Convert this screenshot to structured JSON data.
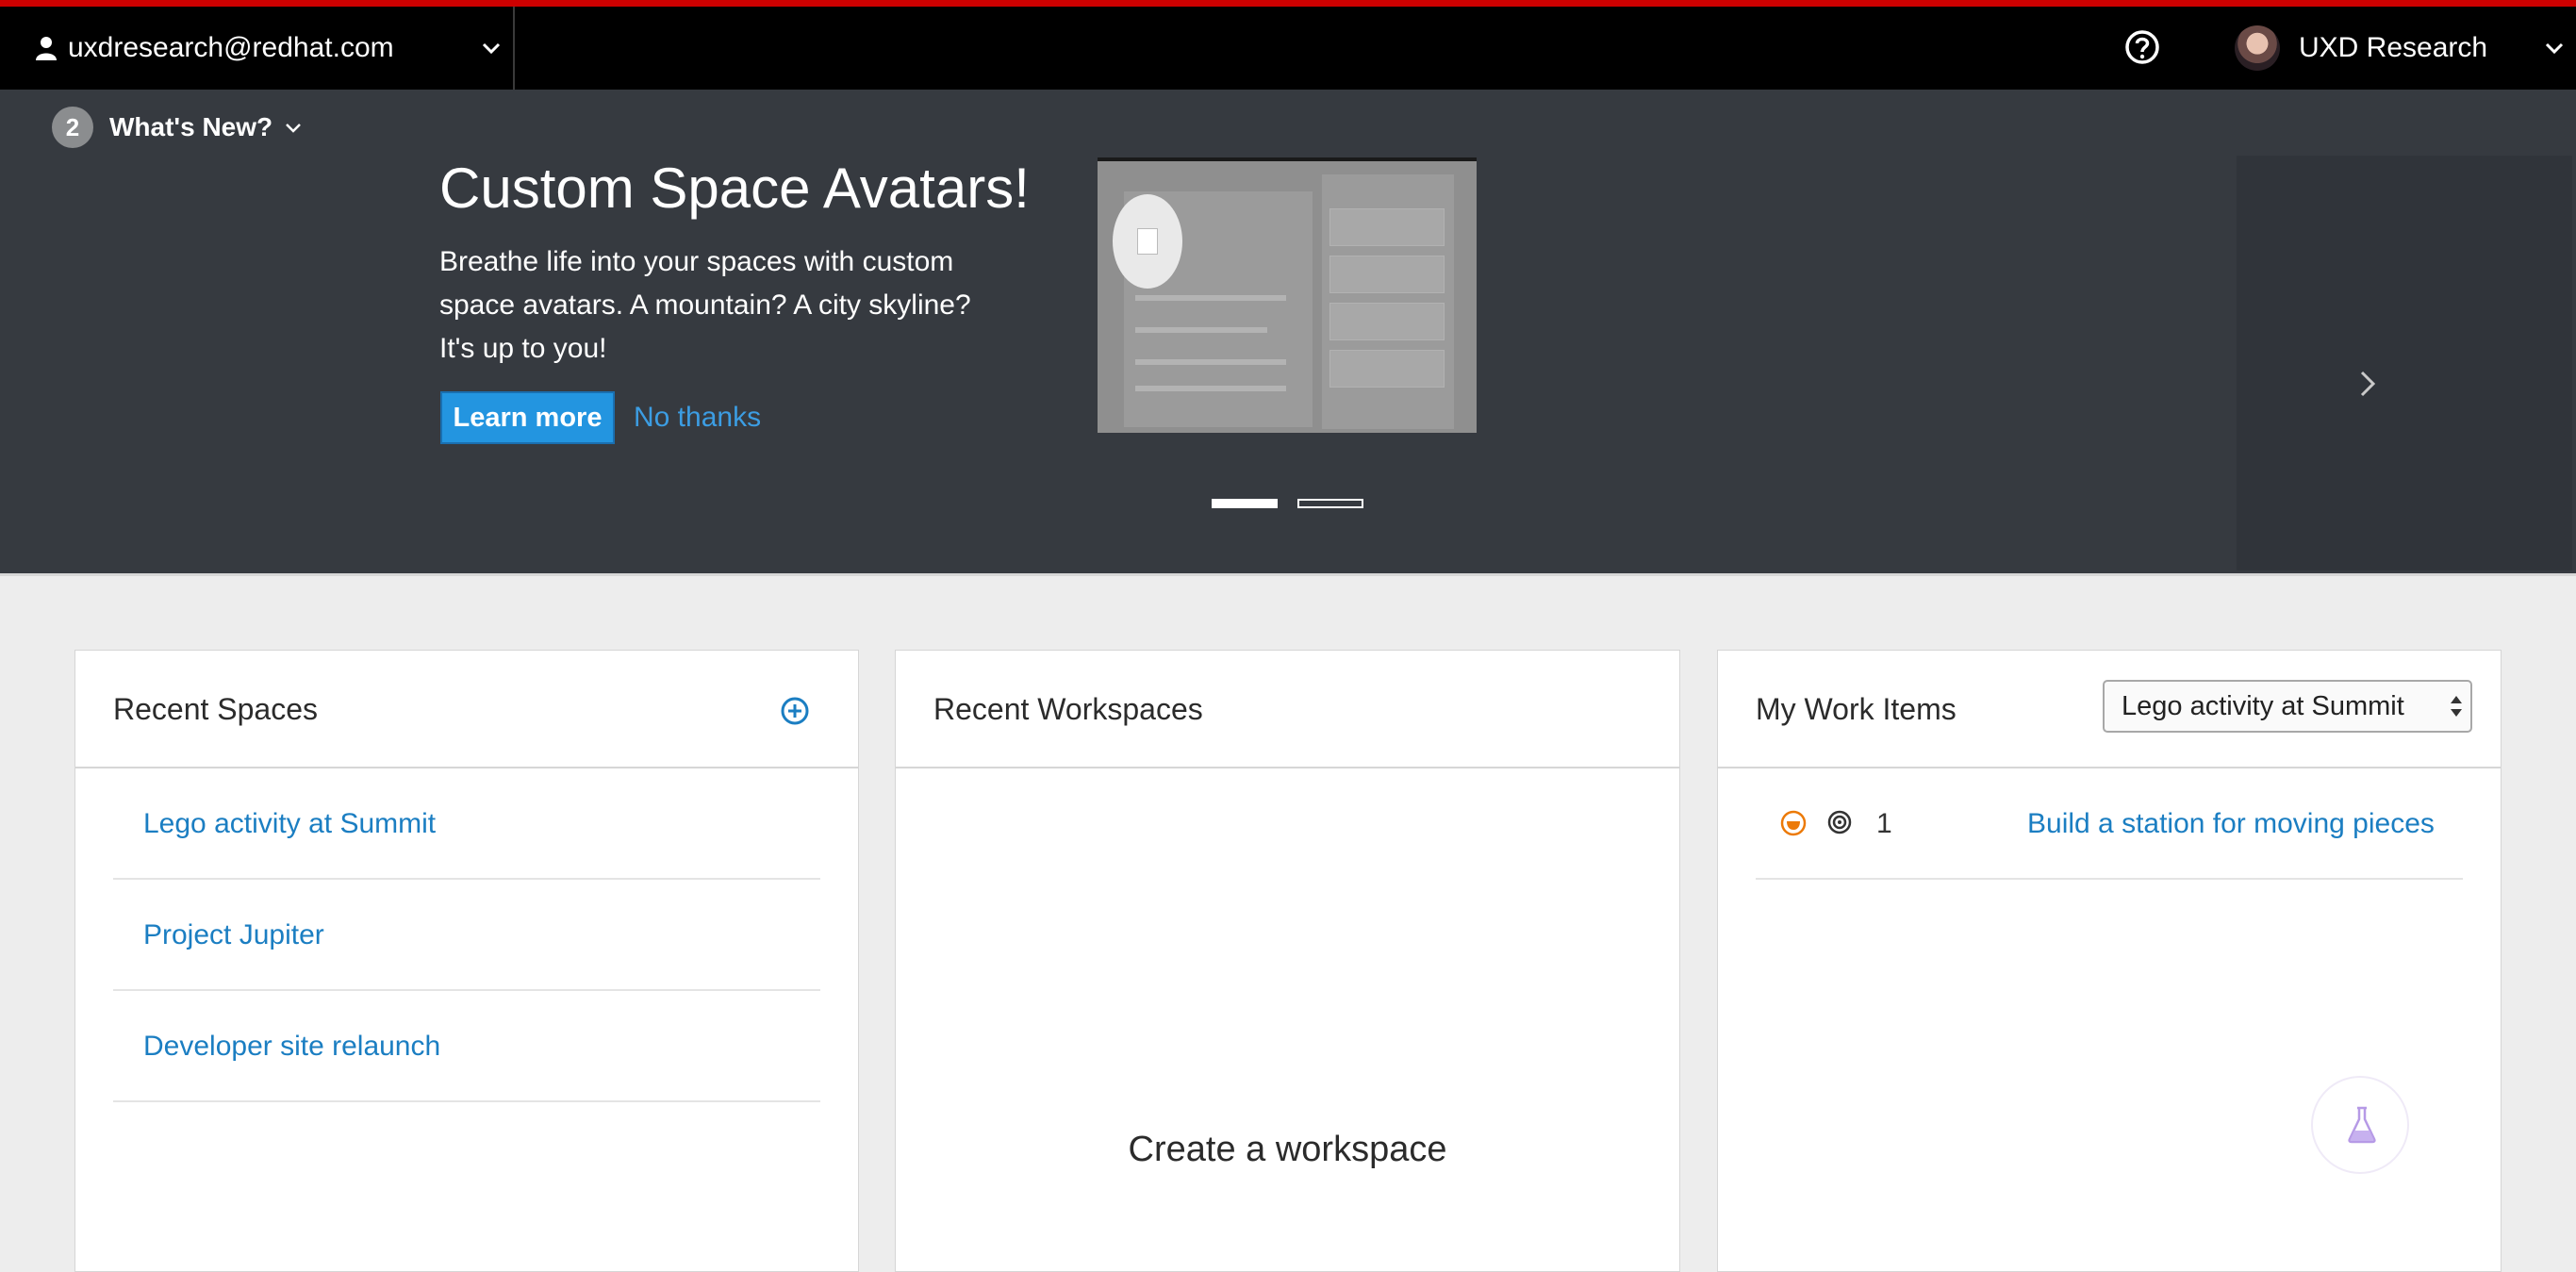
{
  "topbar": {
    "account_email": "uxdresearch@redhat.com",
    "user_name": "UXD Research"
  },
  "whats_new": {
    "count": "2",
    "label": "What's New?",
    "slide": {
      "heading": "Custom Space Avatars!",
      "body": "Breathe life into your spaces with custom space avatars. A mountain? A city skyline? It's up to you!",
      "learn_more": "Learn more",
      "no_thanks": "No thanks"
    },
    "slide_count": 2,
    "active_slide": 1
  },
  "recent_spaces": {
    "title": "Recent Spaces",
    "items": [
      "Lego activity at Summit",
      "Project Jupiter",
      "Developer site relaunch"
    ]
  },
  "recent_workspaces": {
    "title": "Recent Workspaces",
    "empty_title": "Create a workspace"
  },
  "my_work_items": {
    "title": "My Work Items",
    "space_filter": "Lego activity at Summit",
    "items": [
      {
        "id": "1",
        "title": "Build a station for moving pieces",
        "type_icon": "experience-icon",
        "state_icon": "target-icon"
      }
    ]
  },
  "colors": {
    "brand_red": "#cc0000",
    "accent_blue": "#2395e0",
    "link_blue": "#1b7ec2",
    "header_dark": "#363a40",
    "work_item_orange": "#ec7a08"
  }
}
